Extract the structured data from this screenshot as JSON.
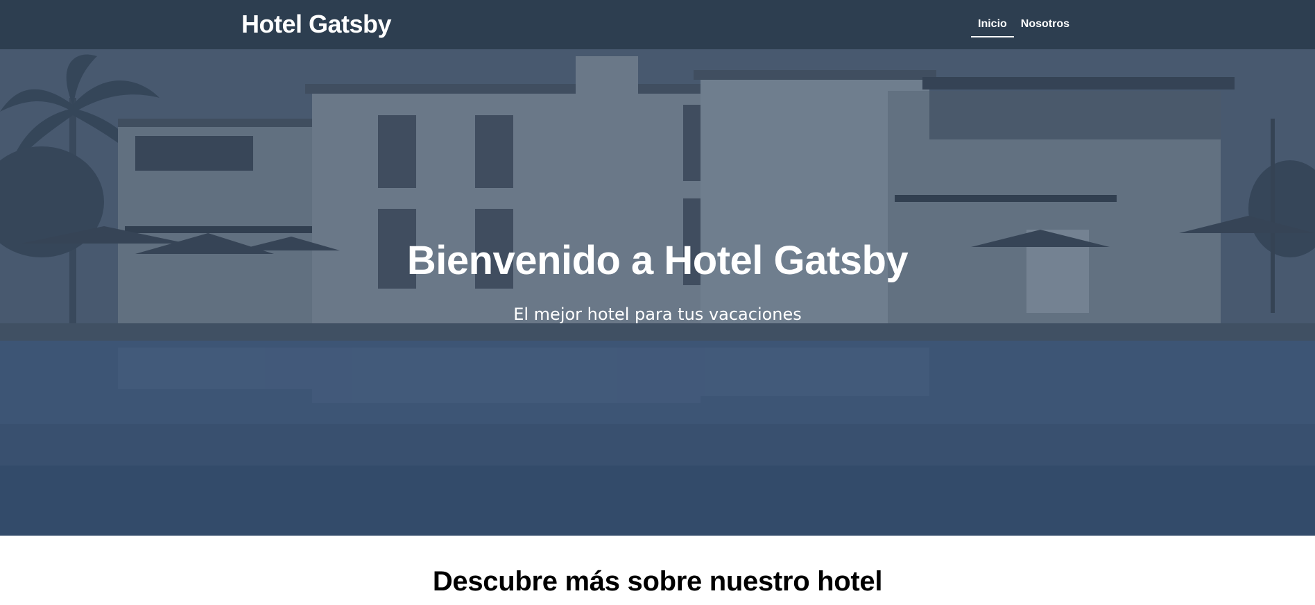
{
  "header": {
    "logo": "Hotel Gatsby",
    "nav": [
      {
        "label": "Inicio",
        "active": true
      },
      {
        "label": "Nosotros",
        "active": false
      }
    ]
  },
  "hero": {
    "title": "Bienvenido a Hotel Gatsby",
    "subtitle": "El mejor hotel para tus vacaciones",
    "image": "hotel-building-with-pool-at-night"
  },
  "section": {
    "title": "Descubre más sobre nuestro hotel"
  },
  "colors": {
    "header_bg": "#2d3e50",
    "hero_overlay": "#2d3e50",
    "text_light": "#ffffff",
    "text_dark": "#000000"
  }
}
